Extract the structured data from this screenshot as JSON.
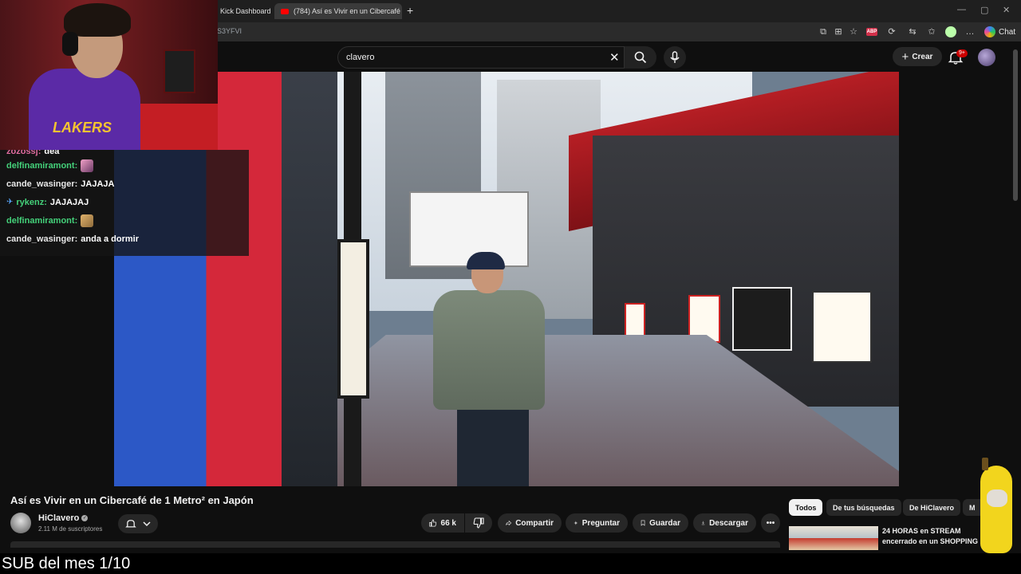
{
  "browser": {
    "tabs": [
      {
        "label": "Kick Dashboard"
      },
      {
        "label": "(784) Así es Vivir en un Cibercafé d"
      }
    ],
    "url_fragment": "S3YFVI",
    "chat_label": "Chat",
    "abp_badge": "ABP"
  },
  "youtube": {
    "search": {
      "value": "clavero"
    },
    "create_label": "Crear",
    "notif_count": "9+"
  },
  "video": {
    "title": "Así es Vivir en un Cibercafé de 1 Metro² en Japón",
    "channel": {
      "name": "HiClavero",
      "subscribers": "2.11 M de suscriptores"
    },
    "actions": {
      "likes": "66 k",
      "share": "Compartir",
      "ask": "Preguntar",
      "save": "Guardar",
      "download": "Descargar"
    }
  },
  "sidebar": {
    "chips": [
      "Todos",
      "De tus búsquedas",
      "De HiClavero",
      "M"
    ],
    "recommended": {
      "title": "24 HORAS en STREAM encerrado en un SHOPPING"
    }
  },
  "stream": {
    "chat": [
      {
        "user": "zozossj:",
        "message": "dea",
        "color": "#e06c9f",
        "emote": ""
      },
      {
        "user": "delfinamiramont:",
        "message": "",
        "color": "#44d17a",
        "emote": "pink"
      },
      {
        "user": "cande_wasinger:",
        "message": "JAJAJA",
        "color": "#e8e8e8",
        "emote": ""
      },
      {
        "user": "rykenz:",
        "message": "JAJAJAJ",
        "color": "#44d17a",
        "emote": "",
        "pin": true
      },
      {
        "user": "delfinamiramont:",
        "message": "",
        "color": "#44d17a",
        "emote": "gold"
      },
      {
        "user": "cande_wasinger:",
        "message": "anda a dormir",
        "color": "#e8e8e8",
        "emote": ""
      }
    ],
    "jersey_text": "LAKERS",
    "banner": "SUB del mes 1/10"
  },
  "icons": {
    "clear": "close-icon",
    "search": "search-icon",
    "mic": "microphone-icon",
    "bell": "bell-icon",
    "like": "thumbs-up-icon",
    "dislike": "thumbs-down-icon",
    "share": "share-icon",
    "ask": "sparkle-icon",
    "save": "bookmark-icon",
    "download": "download-icon",
    "more": "more-horizontal-icon"
  }
}
